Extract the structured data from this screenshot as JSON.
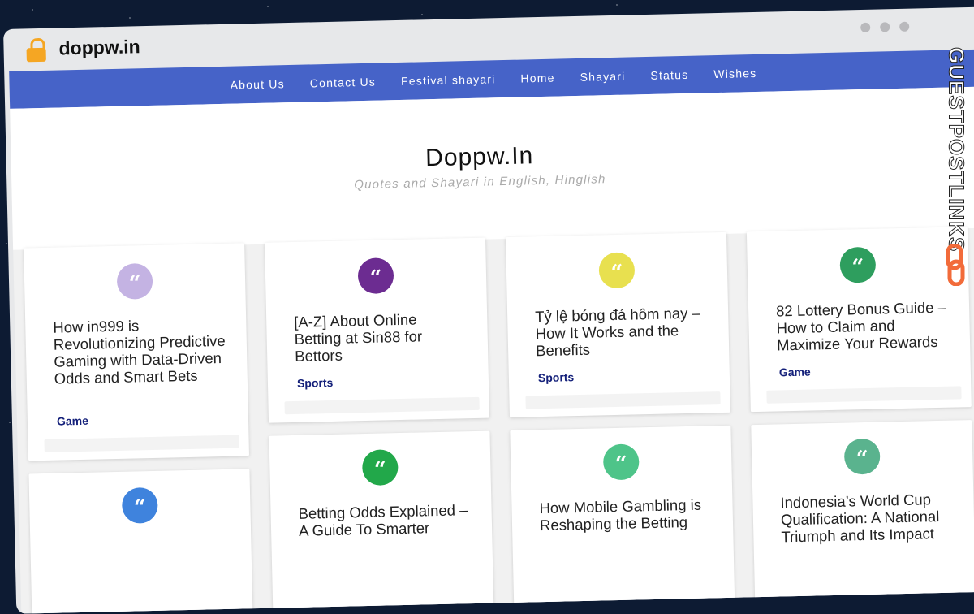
{
  "browser": {
    "domain": "doppw.in"
  },
  "nav": [
    "About Us",
    "Contact Us",
    "Festival shayari",
    "Home",
    "Shayari",
    "Status",
    "Wishes"
  ],
  "site": {
    "title": "Doppw.In",
    "tagline": "Quotes and Shayari in English, Hinglish"
  },
  "cards": [
    {
      "title": "How in999 is Revolutionizing Predictive Gaming with Data-Driven Odds and Smart Bets",
      "category": "Game",
      "icon_color": "#c4b3e3"
    },
    {
      "title": "[A-Z] About Online Betting at Sin88 for Bettors",
      "category": "Sports",
      "icon_color": "#6c2c91"
    },
    {
      "title": "Tỷ lệ bóng đá hôm nay – How It Works and the Benefits",
      "category": "Sports",
      "icon_color": "#e8e04f"
    },
    {
      "title": "82 Lottery Bonus Guide – How to Claim and Maximize Your Rewards",
      "category": "Game",
      "icon_color": "#2e9e5e"
    },
    {
      "title": "",
      "category": "",
      "icon_color": "#3f83dd"
    },
    {
      "title": "Betting Odds Explained – A Guide To Smarter",
      "category": "",
      "icon_color": "#22a84a"
    },
    {
      "title": "How Mobile Gambling is Reshaping the Betting",
      "category": "",
      "icon_color": "#4ec489"
    },
    {
      "title": "Indonesia’s World Cup Qualification: A National Triumph and Its Impact",
      "category": "",
      "icon_color": "#5ab38e"
    }
  ],
  "watermark": {
    "text": "GUESTPOSTLINKS"
  }
}
